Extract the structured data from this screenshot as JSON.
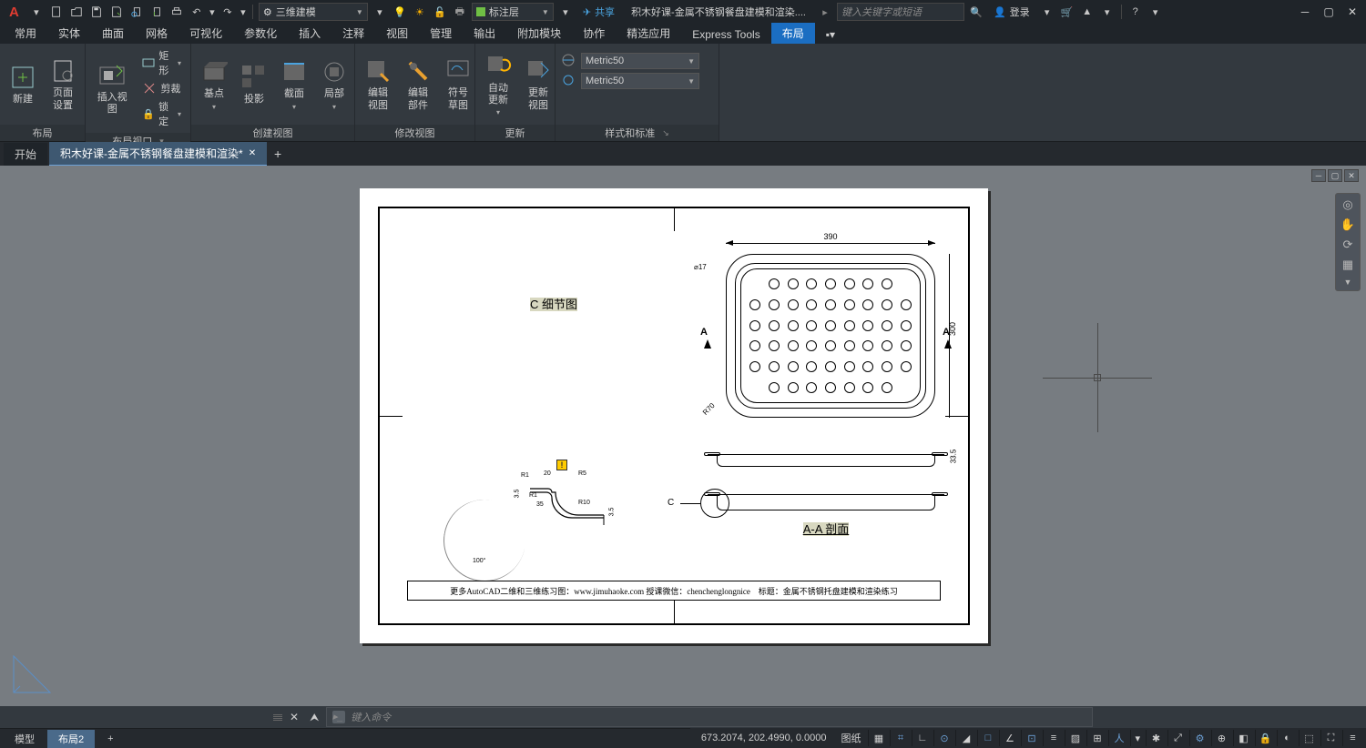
{
  "titlebar": {
    "logo": "A",
    "workspace": "三维建模",
    "layer": "标注层",
    "share": "共享",
    "doc_title": "积木好课-金属不锈钢餐盘建模和渲染....",
    "search_placeholder": "键入关键字或短语",
    "login": "登录"
  },
  "ribbon_tabs": [
    "常用",
    "实体",
    "曲面",
    "网格",
    "可视化",
    "参数化",
    "插入",
    "注释",
    "视图",
    "管理",
    "输出",
    "附加模块",
    "协作",
    "精选应用",
    "Express Tools",
    "布局"
  ],
  "ribbon_active": "布局",
  "ribbon": {
    "panels": {
      "layout": {
        "title": "布局",
        "new": "新建",
        "page_setup": "页面\n设置",
        "rect": "矩形",
        "clip": "剪裁",
        "lock": "锁定",
        "insert_view": "插入视图"
      },
      "layout_viewport": {
        "title": "布局视口"
      },
      "create_view": {
        "title": "创建视图",
        "base": "基点",
        "proj": "投影",
        "section": "截面",
        "detail": "局部"
      },
      "modify_view": {
        "title": "修改视图",
        "edit_view": "编辑\n视图",
        "edit_comp": "编辑\n部件",
        "symbol_sketch": "符号\n草图"
      },
      "update": {
        "title": "更新",
        "auto_update": "自动\n更新",
        "update_view": "更新\n视图"
      },
      "style": {
        "title": "样式和标准",
        "combo1": "Metric50",
        "combo2": "Metric50"
      }
    }
  },
  "file_tabs": {
    "start": "开始",
    "active": "积木好课-金属不锈钢餐盘建模和渲染*"
  },
  "drawing": {
    "dim_width": "390",
    "dim_height": "300",
    "dim_diameter": "⌀17",
    "dim_radius": "R70",
    "dim_335": "33.5",
    "section_a": "A",
    "section_label": "A-A 剖面",
    "detail_c": "C",
    "detail_label": "C 细节图",
    "r1": "R1",
    "r5": "R5",
    "r10": "R10",
    "angle_100": "100°",
    "val_20": "20",
    "val_35": "3.5",
    "val_35b": "35",
    "footer": "更多AutoCAD二维和三维练习图：www.jimuhaoke.com 授课微信：chenchenglongnice　标题：金属不锈钢托盘建模和渲染练习"
  },
  "cmdline": {
    "placeholder": "键入命令"
  },
  "layout_tabs": {
    "model": "模型",
    "layout2": "布局2"
  },
  "statusbar": {
    "coords": "673.2074, 202.4990, 0.0000",
    "paper": "图纸"
  }
}
